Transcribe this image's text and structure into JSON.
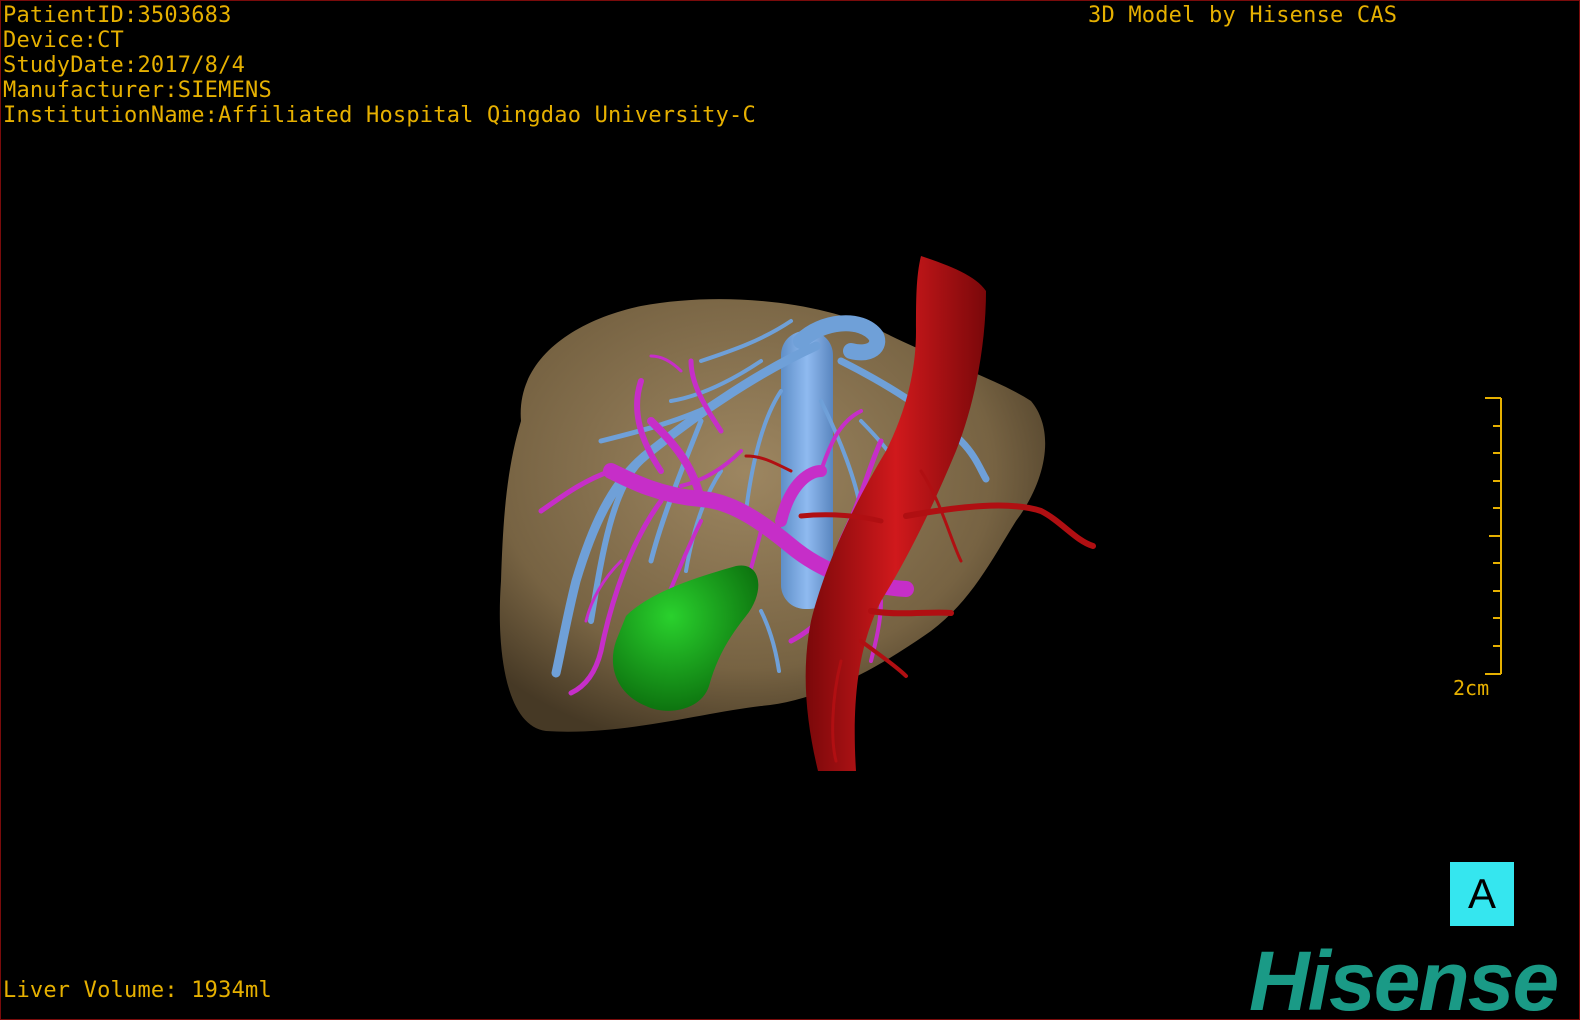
{
  "dicom_info": {
    "patient_id": "PatientID:3503683",
    "device": "Device:CT",
    "study_date": "StudyDate:2017/8/4",
    "manufacturer": "Manufacturer:SIEMENS",
    "institution": "InstitutionName:Affiliated Hospital Qingdao University-C"
  },
  "model_credit": "3D Model by Hisense CAS",
  "liver_volume": "Liver Volume: 1934ml",
  "scale_bar": {
    "label": "2cm"
  },
  "view_label": "A",
  "brand_logo": "Hisense",
  "colors": {
    "overlay_text": "#e6b000",
    "liver": "#8a7350",
    "hepatic_vein": "#6fa0d8",
    "portal_vein": "#c62ec8",
    "artery": "#b00f12",
    "gallbladder": "#13a016",
    "view_label_bg": "#35e6ef",
    "logo": "#1a9a86"
  },
  "structures": [
    "liver",
    "hepatic-vein",
    "portal-vein",
    "artery",
    "gallbladder"
  ]
}
